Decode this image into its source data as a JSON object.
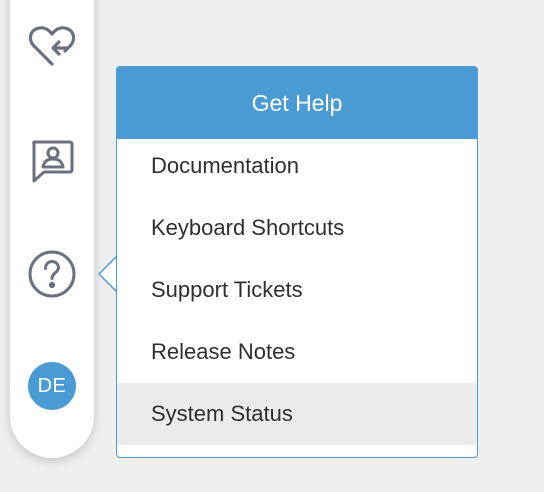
{
  "sidebar": {
    "icons": [
      {
        "name": "heart-return-icon"
      },
      {
        "name": "contact-card-chat-icon"
      },
      {
        "name": "help-question-icon"
      }
    ],
    "avatar_initials": "DE"
  },
  "help_menu": {
    "title": "Get Help",
    "items": [
      {
        "label": "Documentation"
      },
      {
        "label": "Keyboard Shortcuts"
      },
      {
        "label": "Support Tickets"
      },
      {
        "label": "Release Notes"
      },
      {
        "label": "System Status",
        "active": true
      }
    ]
  },
  "colors": {
    "accent": "#4a9ad4",
    "icon_gray": "#6b7080",
    "hover_bg": "#ebebeb",
    "background": "#efefef"
  }
}
